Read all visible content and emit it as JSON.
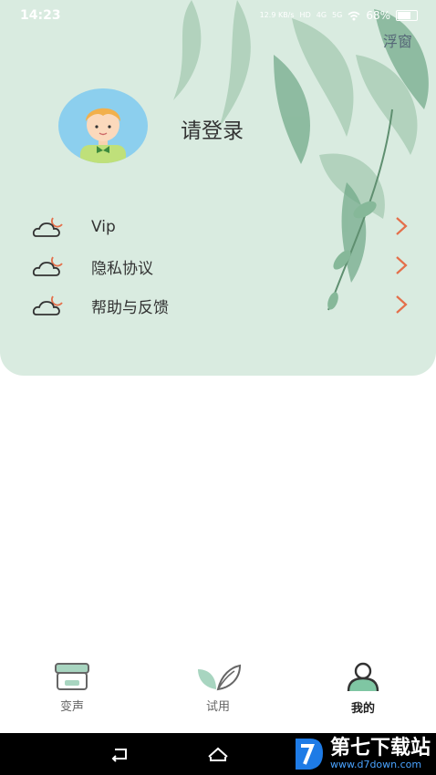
{
  "status_bar": {
    "time": "14:23",
    "speed": "12.9 KB/s",
    "hd": "HD",
    "net1": "4G",
    "net2": "5G",
    "battery": "68%"
  },
  "header": {
    "float_window": "浮窗",
    "login_text": "请登录"
  },
  "menu": {
    "items": [
      {
        "label": "Vip"
      },
      {
        "label": "隐私协议"
      },
      {
        "label": "帮助与反馈"
      }
    ]
  },
  "tabbar": {
    "tabs": [
      {
        "label": "变声",
        "icon": "store-icon"
      },
      {
        "label": "试用",
        "icon": "leaf-icon"
      },
      {
        "label": "我的",
        "icon": "user-icon"
      }
    ],
    "active_tab": "我的"
  },
  "watermark": {
    "text": "第七下载站",
    "url": "www.d7down.com"
  },
  "colors": {
    "header_bg": "#d9ebe0",
    "arrow": "#e46f4a",
    "avatar_bg": "#8ccfee"
  }
}
